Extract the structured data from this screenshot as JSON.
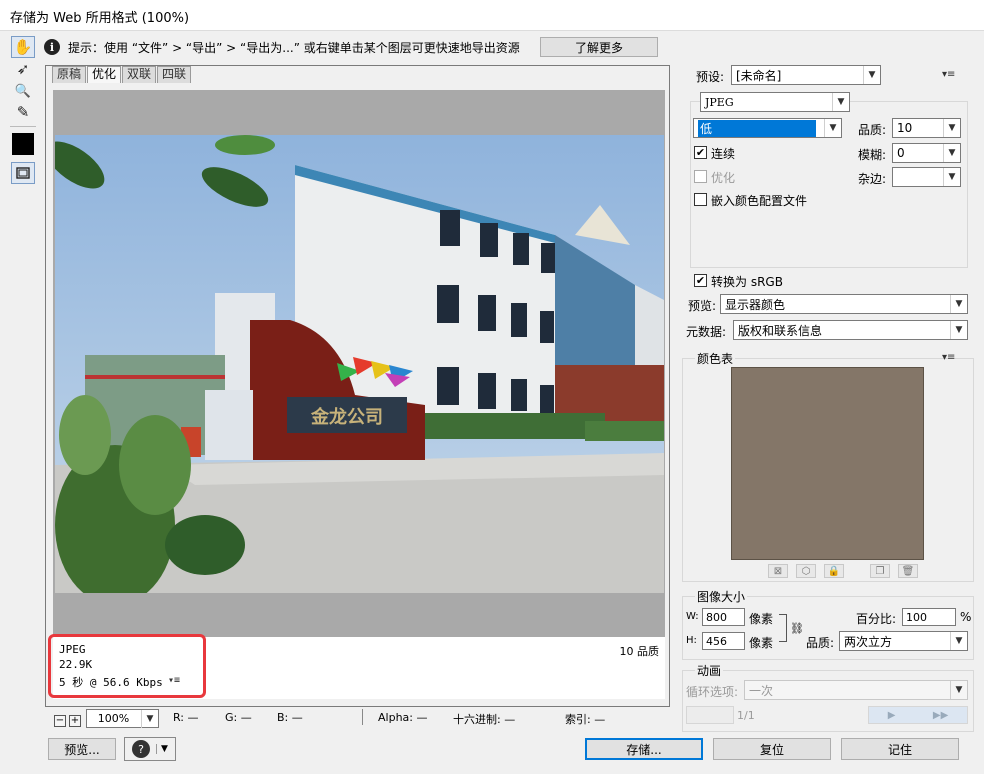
{
  "window": {
    "title": "存储为 Web 所用格式 (100%)"
  },
  "tools": [
    {
      "name": "hand-tool",
      "glyph": "✋"
    },
    {
      "name": "slice-select-tool",
      "glyph": "➶"
    },
    {
      "name": "zoom-tool",
      "glyph": "🔍"
    },
    {
      "name": "eyedropper-tool",
      "glyph": "✎"
    }
  ],
  "info": {
    "text": "提示：使用 “文件” > “导出” > “导出为...” 或右键单击某个图层可更快速地导出资源",
    "learn_more": "了解更多"
  },
  "tabs": [
    "原稿",
    "优化",
    "双联",
    "四联"
  ],
  "active_tab": "优化",
  "photo": {
    "sign_text": "金龙公司"
  },
  "status": {
    "format": "JPEG",
    "size": "22.9K",
    "time": "5 秒 @ 56.6 Kbps",
    "quality": "10 品质"
  },
  "bottombar": {
    "zoom": "100%",
    "r": "R: —",
    "g": "G: —",
    "b": "B: —",
    "alpha": "Alpha: —",
    "hex": "十六进制: —",
    "index": "索引: —"
  },
  "settings": {
    "preset_label": "预设:",
    "preset_value": "[未命名]",
    "format": "JPEG",
    "quality_level": "低",
    "quality_label": "品质:",
    "quality_value": "10",
    "progressive_label": "连续",
    "blur_label": "模糊:",
    "blur_value": "0",
    "optimize_label": "优化",
    "matte_label": "杂边:",
    "embed_profile_label": "嵌入颜色配置文件",
    "convert_srgb_label": "转换为 sRGB",
    "preview_label": "预览:",
    "preview_value": "显示器颜色",
    "metadata_label": "元数据:",
    "metadata_value": "版权和联系信息"
  },
  "color_table": {
    "title": "颜色表",
    "swatch_color": "#847668"
  },
  "image_size": {
    "title": "图像大小",
    "w_label": "W:",
    "w_value": "800",
    "h_label": "H:",
    "h_value": "456",
    "unit": "像素",
    "percent_label": "百分比:",
    "percent_value": "100",
    "percent_unit": "%",
    "quality_label": "品质:",
    "quality_value": "两次立方"
  },
  "animation": {
    "title": "动画",
    "loop_label": "循环选项:",
    "loop_value": "一次",
    "frame_counter": "1/1"
  },
  "buttons": {
    "preview": "预览...",
    "save": "存储...",
    "reset": "复位",
    "remember": "记住"
  },
  "colors": {
    "accent": "#0078d7",
    "highlight": "#e8383d"
  }
}
